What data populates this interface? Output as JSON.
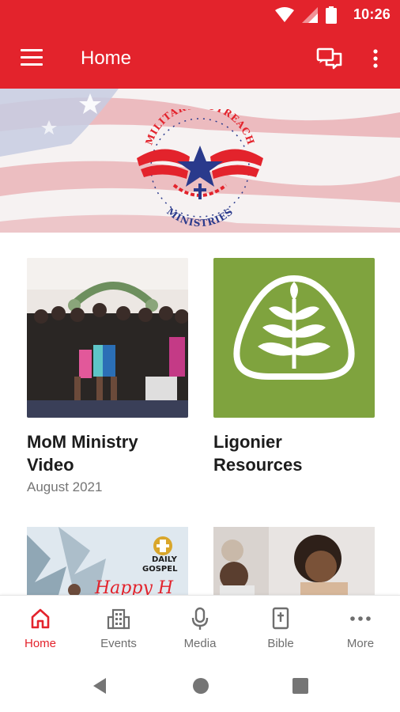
{
  "status_bar": {
    "time": "10:26"
  },
  "app_bar": {
    "title": "Home"
  },
  "hero": {
    "logo_top_text": "MILITARY OUTREACH",
    "logo_bottom_text": "MINISTRIES"
  },
  "tiles": [
    {
      "title_line1": "MoM Ministry",
      "title_line2": "Video",
      "subtitle": "August 2021"
    },
    {
      "title_line1": "Ligonier",
      "title_line2": "Resources",
      "subtitle": ""
    }
  ],
  "lower_tiles": [
    {
      "overlay_text1": "DAILY",
      "overlay_text2": "GOSPEL",
      "overlay_text3": "Happy H"
    },
    {
      "overlay_text1": ""
    }
  ],
  "bottom_nav": [
    {
      "label": "Home",
      "icon": "home-icon",
      "active": true
    },
    {
      "label": "Events",
      "icon": "building-icon",
      "active": false
    },
    {
      "label": "Media",
      "icon": "microphone-icon",
      "active": false
    },
    {
      "label": "Bible",
      "icon": "bible-icon",
      "active": false
    },
    {
      "label": "More",
      "icon": "more-horizontal-icon",
      "active": false
    }
  ],
  "colors": {
    "primary": "#e3232c",
    "ligonier_green": "#7fa33e",
    "nav_inactive": "#6e6e6e"
  }
}
